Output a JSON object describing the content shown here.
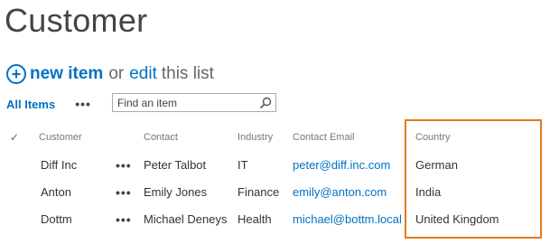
{
  "page": {
    "title": "Customer"
  },
  "actions": {
    "new_item": "new item",
    "or": "or",
    "edit": "edit",
    "this_list": "this list"
  },
  "view": {
    "all_items": "All Items",
    "ellipsis": "•••",
    "search_placeholder": "Find an item"
  },
  "table": {
    "columns": [
      "Customer",
      "Contact",
      "Industry",
      "Contact Email",
      "Country"
    ],
    "rows": [
      {
        "customer": "Diff Inc",
        "contact": "Peter Talbot",
        "industry": "IT",
        "email": "peter@diff.inc.com",
        "country": "German"
      },
      {
        "customer": "Anton",
        "contact": "Emily Jones",
        "industry": "Finance",
        "email": "emily@anton.com",
        "country": "India"
      },
      {
        "customer": "Dottm",
        "contact": "Michael Deneys",
        "industry": "Health",
        "email": "michael@bottm.local",
        "country": "United Kingdom"
      }
    ],
    "row_ellipsis": "•••"
  },
  "colors": {
    "link": "#0072c6",
    "highlight_border": "#e07b1a",
    "text": "#444444"
  }
}
